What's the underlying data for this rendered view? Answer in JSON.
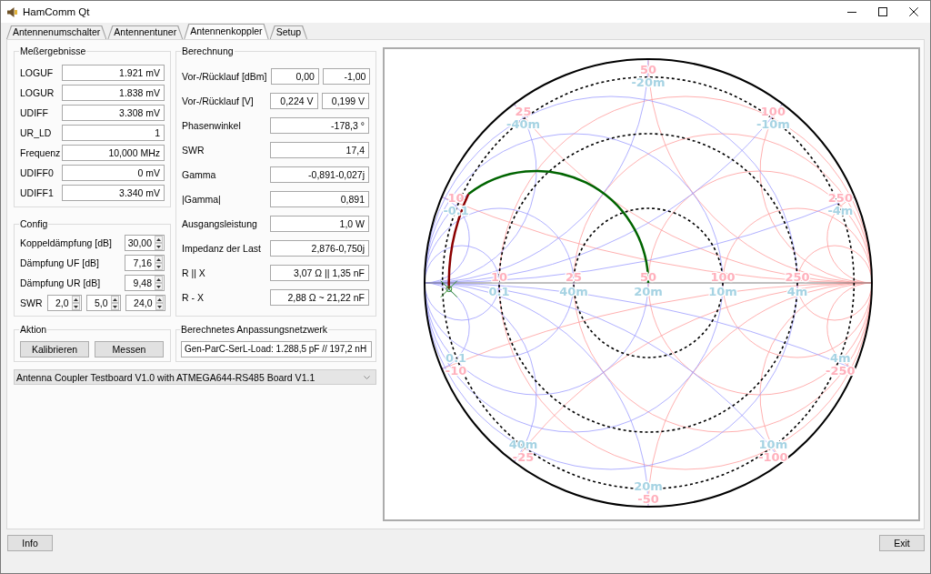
{
  "window": {
    "title": "HamComm Qt"
  },
  "tabs": [
    {
      "label": "Antennenumschalter",
      "selected": false
    },
    {
      "label": "Antennentuner",
      "selected": false
    },
    {
      "label": "Antennenkoppler",
      "selected": true
    },
    {
      "label": "Setup",
      "selected": false
    }
  ],
  "measurements": {
    "title": "Meßergebnisse",
    "rows": [
      {
        "label": "LOGUF",
        "value": "1.921 mV"
      },
      {
        "label": "LOGUR",
        "value": "1.838 mV"
      },
      {
        "label": "UDIFF",
        "value": "3.308 mV"
      },
      {
        "label": "UR_LD",
        "value": "1"
      },
      {
        "label": "Frequenz",
        "value": "10,000 MHz"
      },
      {
        "label": "UDIFF0",
        "value": "0 mV"
      },
      {
        "label": "UDIFF1",
        "value": "3.340 mV"
      }
    ]
  },
  "config": {
    "title": "Config",
    "rows": [
      {
        "label": "Koppeldämpfung [dB]",
        "values": [
          "30,00"
        ]
      },
      {
        "label": "Dämpfung UF [dB]",
        "values": [
          "7,16"
        ]
      },
      {
        "label": "Dämpfung UR [dB]",
        "values": [
          "9,48"
        ]
      },
      {
        "label": "SWR",
        "values": [
          "2,0",
          "5,0",
          "24,0"
        ]
      }
    ]
  },
  "calculation": {
    "title": "Berechnung",
    "rows": [
      {
        "label": "Vor-/Rücklauf [dBm]",
        "values": [
          "0,00",
          "-1,00"
        ]
      },
      {
        "label": "Vor-/Rücklauf [V]",
        "values": [
          "0,224 V",
          "0,199 V"
        ]
      },
      {
        "label": "Phasenwinkel",
        "values": [
          "-178,3 °"
        ]
      },
      {
        "label": "SWR",
        "values": [
          "17,4"
        ]
      },
      {
        "label": "Gamma",
        "values": [
          "-0,891-0,027j"
        ]
      },
      {
        "label": "|Gamma|",
        "values": [
          "0,891"
        ]
      },
      {
        "label": "Ausgangsleistung",
        "values": [
          "1,0 W"
        ]
      },
      {
        "label": "Impedanz der Last",
        "values": [
          "2,876-0,750j"
        ]
      },
      {
        "label": "R || X",
        "values": [
          "3,07 Ω || 1,35 nF"
        ]
      },
      {
        "label": "R - X",
        "values": [
          "2,88 Ω ~ 21,22 nF"
        ]
      }
    ]
  },
  "actions": {
    "title": "Aktion",
    "buttons": [
      "Kalibrieren",
      "Messen"
    ]
  },
  "matching_network": {
    "title": "Berechnetes Anpassungsnetzwerk",
    "value": "Gen-ParC-SerL-Load: 1.288,5 pF // 197,2 nH"
  },
  "board_select": {
    "value": "Antenna Coupler Testboard V1.0 with ATMEGA644-RS485 Board V1.1"
  },
  "smith_chart": {
    "axis_labels": [
      {
        "resistance": "10",
        "conductance": "0.1"
      },
      {
        "resistance": "25",
        "conductance": "40m"
      },
      {
        "resistance": "50",
        "conductance": "20m"
      },
      {
        "resistance": "100",
        "conductance": "10m"
      },
      {
        "resistance": "250",
        "conductance": "4m"
      }
    ],
    "upper_labels": [
      {
        "reactance": "10",
        "susceptance": "-0.1"
      },
      {
        "reactance": "25",
        "susceptance": "-40m"
      },
      {
        "reactance": "50",
        "susceptance": "-20m"
      },
      {
        "reactance": "100",
        "susceptance": "-10m"
      },
      {
        "reactance": "250",
        "susceptance": "-4m"
      }
    ],
    "lower_labels": [
      {
        "reactance": "-10",
        "susceptance": "0.1"
      },
      {
        "reactance": "-25",
        "susceptance": "40m"
      },
      {
        "reactance": "-50",
        "susceptance": "20m"
      },
      {
        "reactance": "-100",
        "susceptance": "10m"
      },
      {
        "reactance": "-250",
        "susceptance": "4m"
      }
    ]
  },
  "footer_buttons": [
    "Info",
    "Exit"
  ]
}
